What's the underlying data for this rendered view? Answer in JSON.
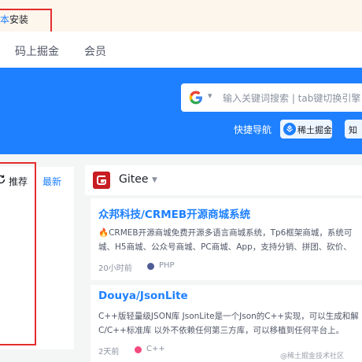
{
  "notice": {
    "link_text": "本",
    "text": "安装"
  },
  "nav": {
    "items": [
      "码上掘金",
      "会员"
    ]
  },
  "search": {
    "placeholder": "输入关键词搜索 | tab键切换引擎"
  },
  "shortcuts": {
    "quick_nav": "快捷导航",
    "juejin": "稀土掘金",
    "zhi": "知"
  },
  "feed_tabs": {
    "recommended": "推荐",
    "latest": "最新"
  },
  "source": {
    "name": "Gitee"
  },
  "cards": [
    {
      "title": "众邦科技/CRMEB开源商城系统",
      "desc_line1": "🔥CRMEB开源商城免费开源多语言商城系统，Tp6框架商城，系统可",
      "desc_line2": "城、H5商城、公众号商城、PC商城、App，支持分销、拼团、砍价、",
      "time": "20小时前",
      "language": "PHP"
    },
    {
      "title": "Douya/JsonLite",
      "desc_line1": "C++版轻量级JSON库 JsonLite是一个Json的C++实现，可以生成和解",
      "desc_line2": "C/C++标准库 以外不依赖任何第三方库，可以移植到任何平台上。",
      "time": "2天前",
      "language": "C++"
    }
  ],
  "watermark": "@稀土掘金技术社区",
  "colors": {
    "brand": "#1e80ff",
    "highlight": "#e32e2e",
    "php": "#4f5d95",
    "cpp": "#f34b7d",
    "gitee": "#c71d23"
  }
}
